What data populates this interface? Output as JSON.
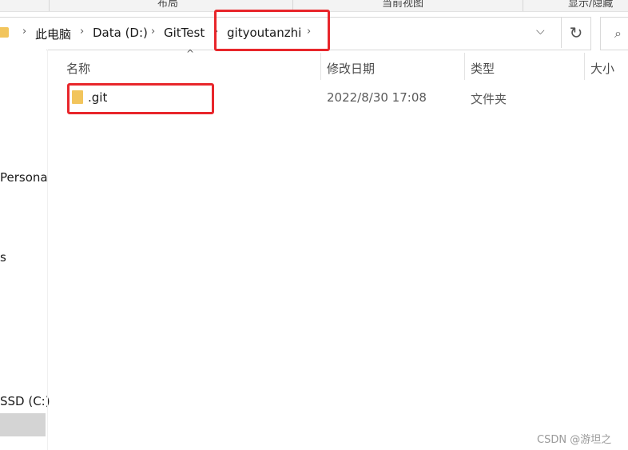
{
  "ribbon": {
    "groups": [
      "布局",
      "当前视图",
      "显示/隐藏"
    ]
  },
  "address_bar": {
    "segments": [
      "此电脑",
      "Data (D:)",
      "GitTest",
      "gityoutanzhi"
    ],
    "dropdown_icon": "chevron-down-icon",
    "refresh_icon": "refresh-icon",
    "search_icon": "search-icon"
  },
  "nav_pane": {
    "items": [
      "Persona",
      "s",
      "SSD (C:)"
    ]
  },
  "columns": {
    "name": "名称",
    "modified": "修改日期",
    "type": "类型",
    "size": "大小"
  },
  "files": [
    {
      "name": ".git",
      "modified": "2022/8/30 17:08",
      "type": "文件夹",
      "size": ""
    }
  ],
  "annotation_color": "#e8262b",
  "folder_color": "#f2c55c",
  "watermark": "CSDN @游坦之"
}
